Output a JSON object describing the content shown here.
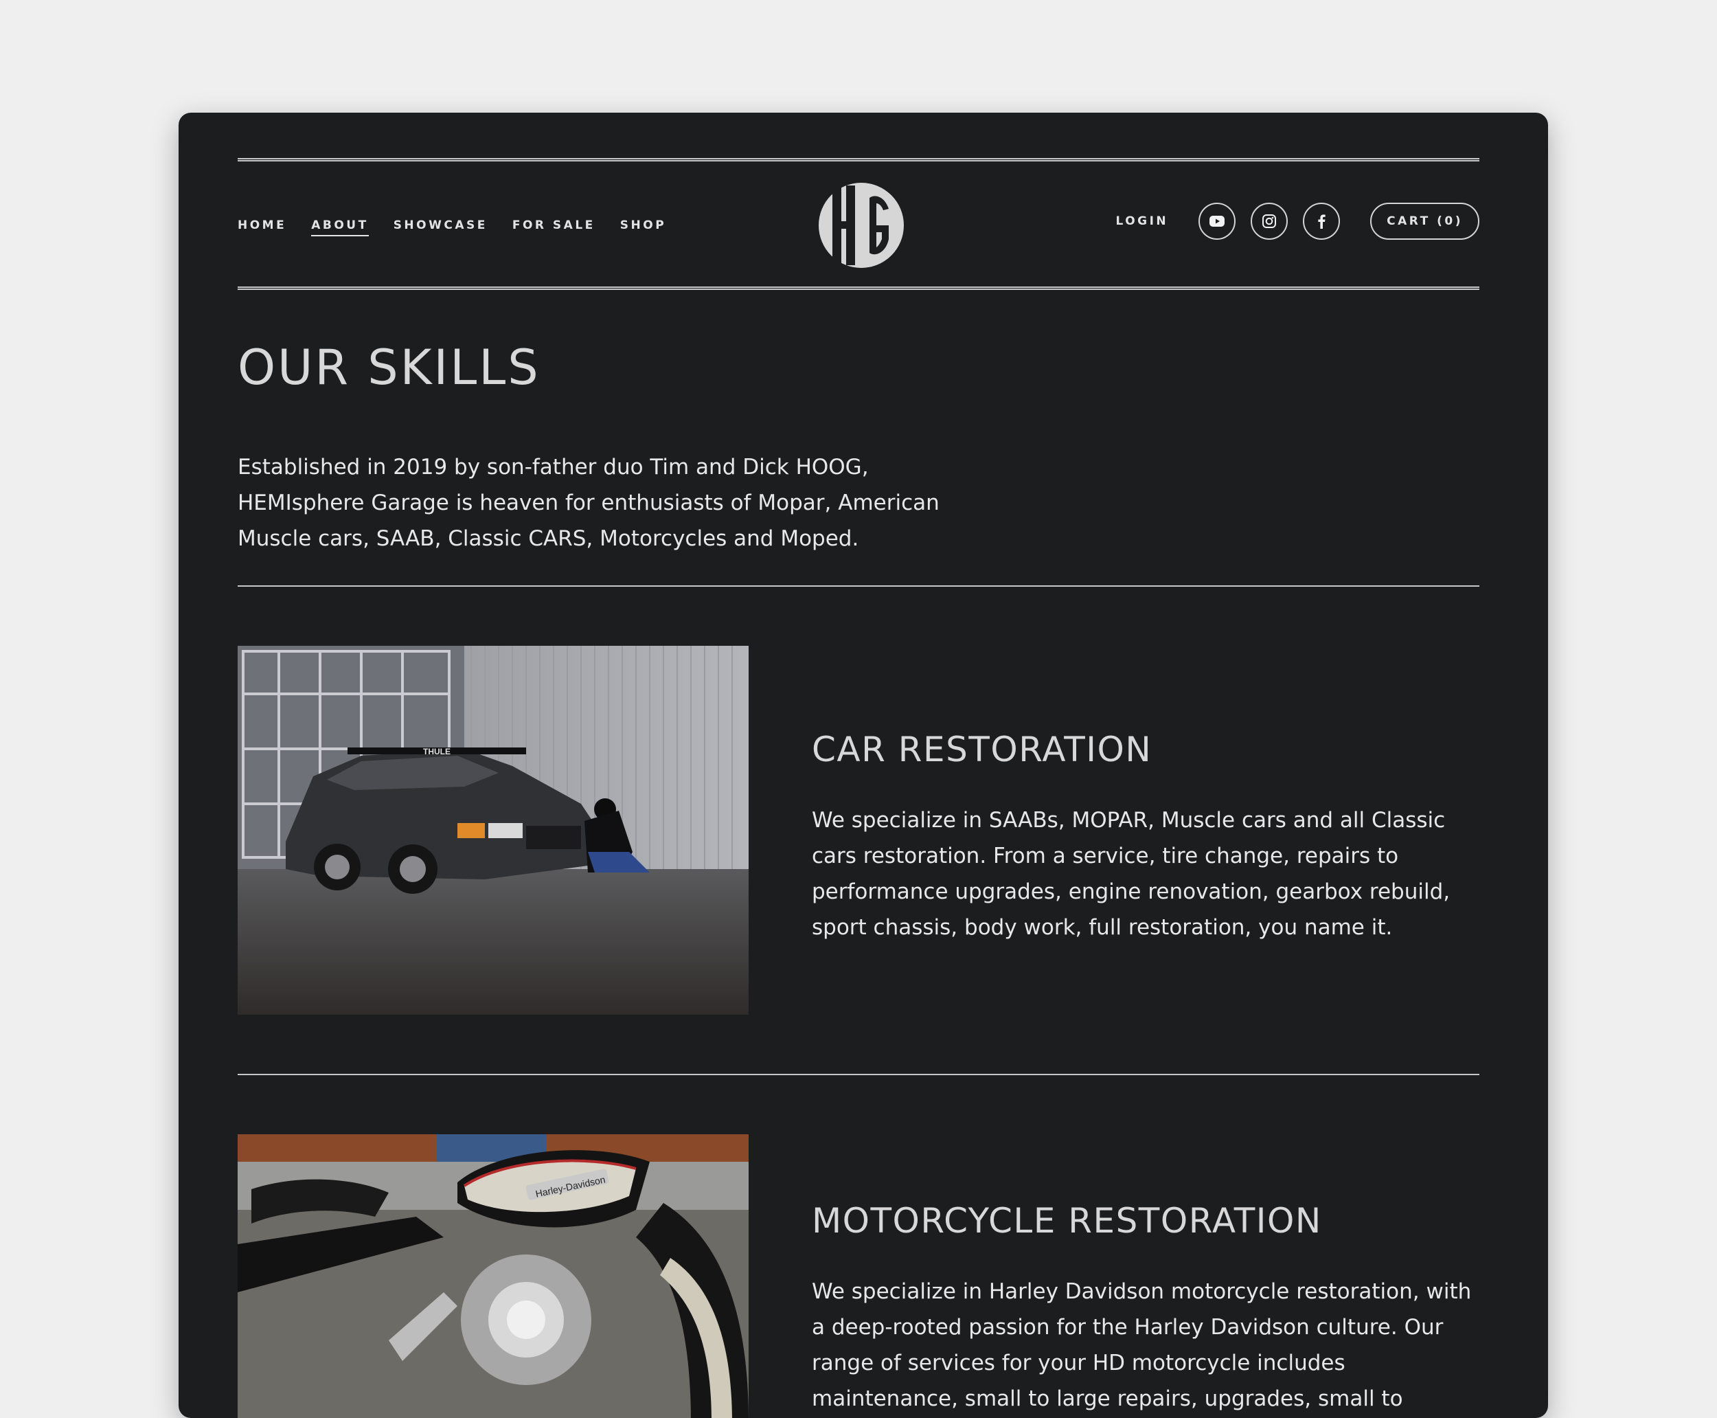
{
  "nav": {
    "items": [
      "HOME",
      "ABOUT",
      "SHOWCASE",
      "FOR SALE",
      "SHOP"
    ],
    "active": "ABOUT"
  },
  "logo": {
    "text": "HG"
  },
  "header": {
    "login_label": "LOGIN",
    "cart_label": "CART (0)",
    "social_icons": [
      "youtube-icon",
      "instagram-icon",
      "facebook-icon"
    ]
  },
  "main": {
    "title": "OUR SKILLS",
    "intro": "Established in 2019 by son-father duo Tim and Dick HOOG, HEMIsphere Garage is heaven for enthusiasts of Mopar, American Muscle cars, SAAB, Classic CARS, Motorcycles and Moped.",
    "sections": [
      {
        "title": "CAR RESTORATION",
        "text": "We specialize in SAABs, MOPAR, Muscle cars and all Classic cars restoration. From a service, tire change, repairs to performance upgrades, engine renovation, gearbox rebuild, sport chassis, body work, full restoration, you name it.",
        "image_roof_label": "THULE"
      },
      {
        "title": "MOTORCYCLE RESTORATION",
        "text": "We specialize in Harley Davidson motorcycle restoration, with a deep-rooted passion for the Harley Davidson culture. Our range of services for your HD motorcycle includes maintenance, small to large repairs, upgrades, small to extensive projects, and",
        "image_tank_label": "Harley-Davidson"
      }
    ]
  },
  "colors": {
    "page_bg": "#efefef",
    "panel_bg": "#1c1d1f",
    "text": "#e4e4e4",
    "rule": "#c7c7c7"
  }
}
